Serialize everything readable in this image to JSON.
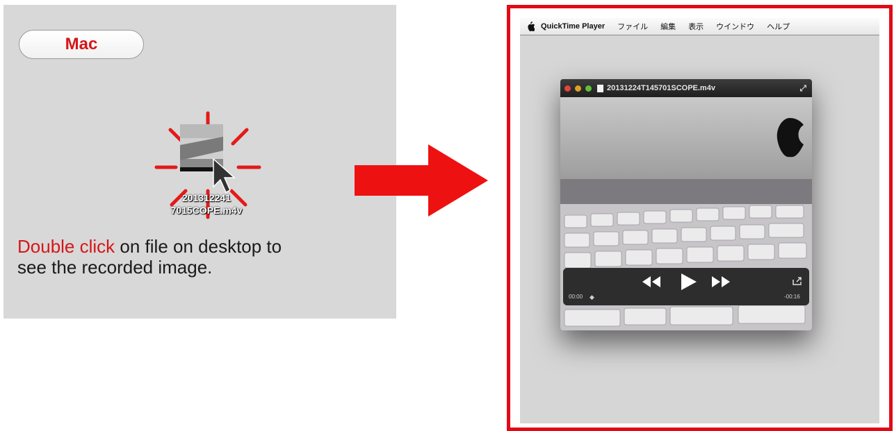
{
  "left": {
    "mac_label": "Mac",
    "file_name_line1": "201312241",
    "file_name_line2": "7015COPE.m4v",
    "instruction_highlight": "Double click",
    "instruction_rest_line1": " on file on desktop to",
    "instruction_line2": "see the recorded image."
  },
  "right": {
    "menubar": {
      "app_name": "QuickTime Player",
      "items": [
        "ファイル",
        "編集",
        "表示",
        "ウインドウ",
        "ヘルプ"
      ]
    },
    "player": {
      "title": "20131224T145701SCOPE.m4v",
      "time_elapsed": "00:00",
      "time_remaining": "-00:16"
    }
  },
  "colors": {
    "accent_red": "#e10b17",
    "highlight_red": "#d71518"
  },
  "icons": [
    "apple-icon",
    "video-file-icon",
    "mouse-cursor-icon",
    "right-arrow-icon",
    "rewind-icon",
    "play-icon",
    "fast-forward-icon",
    "share-icon",
    "fullscreen-icon",
    "document-icon"
  ]
}
